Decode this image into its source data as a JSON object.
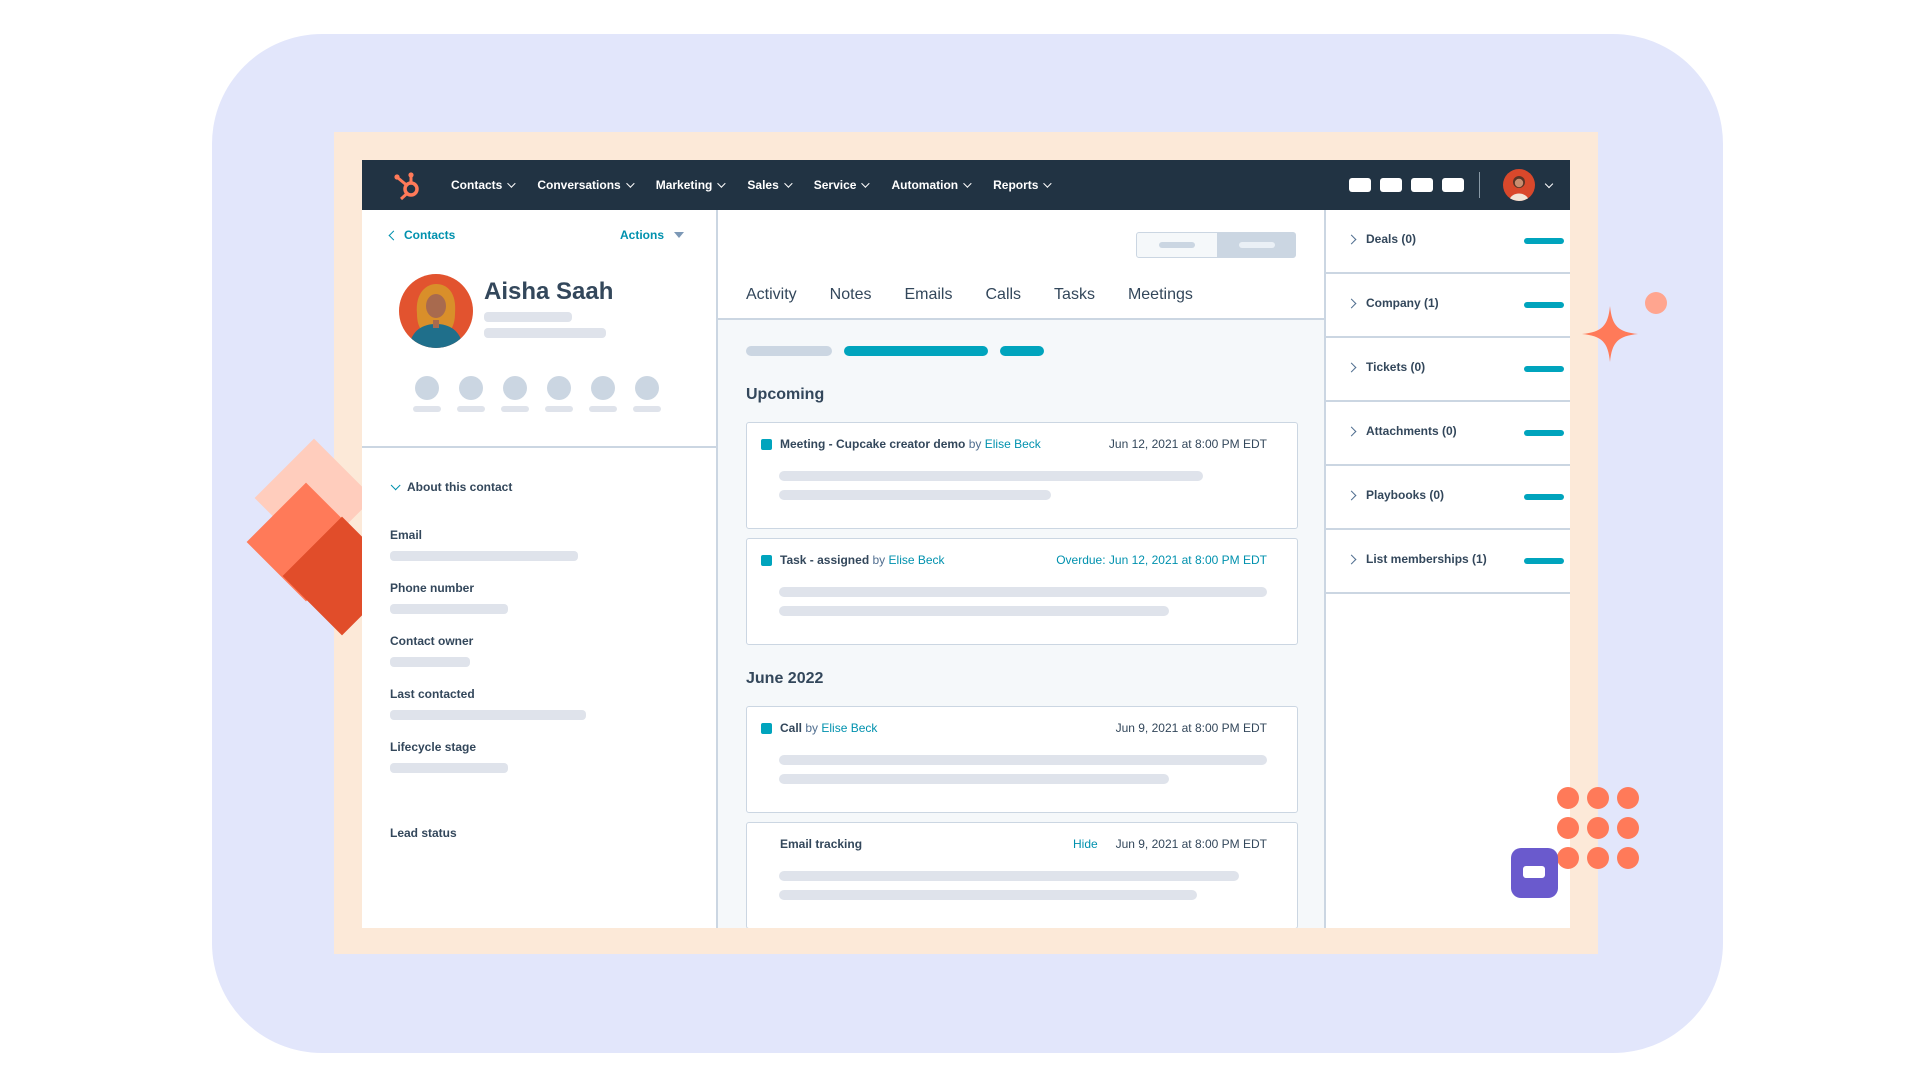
{
  "nav": {
    "items": [
      {
        "label": "Contacts"
      },
      {
        "label": "Conversations"
      },
      {
        "label": "Marketing"
      },
      {
        "label": "Sales"
      },
      {
        "label": "Service"
      },
      {
        "label": "Automation"
      },
      {
        "label": "Reports"
      }
    ]
  },
  "contact": {
    "back_label": "Contacts",
    "actions_label": "Actions",
    "name": "Aisha Saah",
    "about_label": "About this contact",
    "properties": [
      {
        "label": "Email"
      },
      {
        "label": "Phone number"
      },
      {
        "label": "Contact owner"
      },
      {
        "label": "Last contacted"
      },
      {
        "label": "Lifecycle stage"
      },
      {
        "label": "Lead status"
      }
    ]
  },
  "timeline": {
    "tabs": [
      "Activity",
      "Notes",
      "Emails",
      "Calls",
      "Tasks",
      "Meetings"
    ],
    "sections": [
      {
        "title": "Upcoming",
        "cards": [
          {
            "title": "Meeting - Cupcake creator demo",
            "by": "by",
            "author": "Elise Beck",
            "date": "Jun 12, 2021 at 8:00 PM EDT"
          },
          {
            "title": "Task - assigned",
            "by": "by",
            "author": "Elise Beck",
            "date": "Overdue: Jun 12, 2021 at 8:00 PM EDT"
          }
        ]
      },
      {
        "title": "June 2022",
        "cards": [
          {
            "title": "Call",
            "by": "by",
            "author": "Elise Beck",
            "date": "Jun 9, 2021 at 8:00 PM EDT"
          },
          {
            "title": "Email tracking",
            "hide_label": "Hide",
            "date": "Jun 9, 2021 at 8:00 PM EDT"
          }
        ]
      }
    ]
  },
  "associations": [
    {
      "label": "Deals (0)"
    },
    {
      "label": "Company (1)"
    },
    {
      "label": "Tickets (0)"
    },
    {
      "label": "Attachments (0)"
    },
    {
      "label": "Playbooks (0)"
    },
    {
      "label": "List memberships (1)"
    }
  ],
  "colors": {
    "nav_bg": "#213343",
    "accent_teal": "#00a4bd",
    "brand_orange": "#ff7a59",
    "frame_peach": "#fce9d8",
    "background_lavender": "#e2e6fb",
    "chat_purple": "#6a5acd"
  },
  "icons": {
    "logo": "hubspot-sprocket-logo",
    "chat": "chat-bubble-icon"
  }
}
